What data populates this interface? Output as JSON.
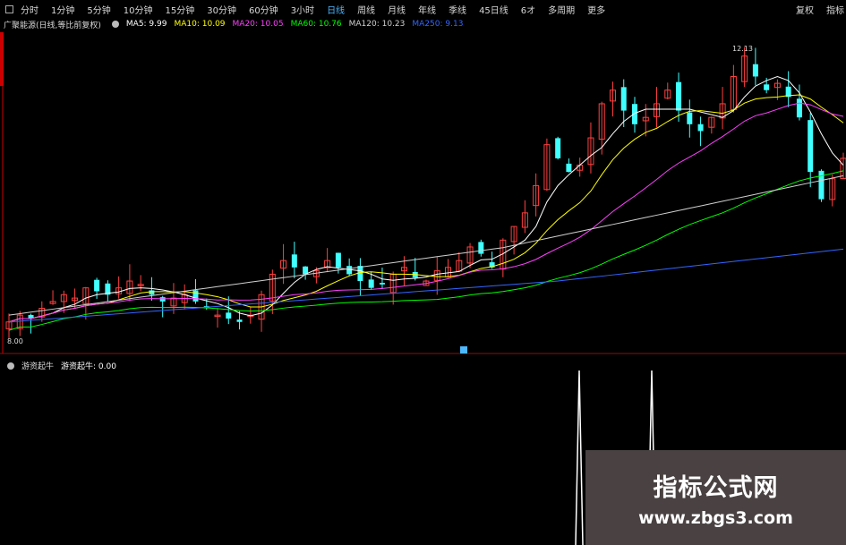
{
  "toolbar": {
    "tabs": [
      "分时",
      "1分钟",
      "5分钟",
      "10分钟",
      "15分钟",
      "30分钟",
      "60分钟",
      "3小时",
      "日线",
      "周线",
      "月线",
      "年线",
      "季线",
      "45日线",
      "6オ",
      "多周期",
      "更多"
    ],
    "active_tab": "日线",
    "right_tabs": [
      "复权",
      "指标"
    ]
  },
  "info": {
    "stock": "广聚能源(日线,等比前复权)",
    "ma5": "MA5: 9.99",
    "ma10": "MA10: 10.09",
    "ma20": "MA20: 10.05",
    "ma60": "MA60: 10.76",
    "ma120": "MA120: 10.23",
    "ma250": "MA250: 9.13",
    "colors": {
      "ma5": "#ffffff",
      "ma10": "#ffff00",
      "ma20": "#ff40ff",
      "ma60": "#00ff00",
      "ma120": "#d0d0d0",
      "ma250": "#3366ff"
    }
  },
  "chart": {
    "high_label": "12.13",
    "low_label": "8.00"
  },
  "sub": {
    "indicator_name": "游资起牛",
    "value_label": "游资起牛: 0.00"
  },
  "watermark": {
    "title": "指标公式网",
    "url": "www.zbgs3.com"
  },
  "chart_data": {
    "type": "candlestick",
    "closes": [
      8.2,
      8.3,
      8.25,
      8.4,
      8.5,
      8.6,
      8.55,
      8.7,
      8.65,
      8.6,
      8.7,
      8.8,
      8.75,
      8.6,
      8.5,
      8.55,
      8.6,
      8.5,
      8.4,
      8.3,
      8.25,
      8.2,
      8.3,
      8.6,
      8.9,
      9.1,
      9.0,
      8.9,
      8.95,
      9.1,
      9.0,
      8.9,
      8.8,
      8.7,
      8.75,
      8.9,
      9.0,
      8.85,
      8.8,
      8.95,
      9.0,
      9.1,
      9.3,
      9.2,
      9.0,
      9.4,
      9.6,
      9.8,
      10.2,
      10.8,
      10.6,
      10.4,
      10.5,
      10.9,
      11.4,
      11.6,
      11.3,
      11.1,
      11.2,
      11.4,
      11.6,
      11.3,
      11.1,
      11.0,
      11.2,
      11.4,
      11.8,
      12.1,
      11.8,
      11.6,
      11.7,
      11.5,
      11.2,
      10.4,
      10.0,
      10.3,
      10.6
    ]
  }
}
